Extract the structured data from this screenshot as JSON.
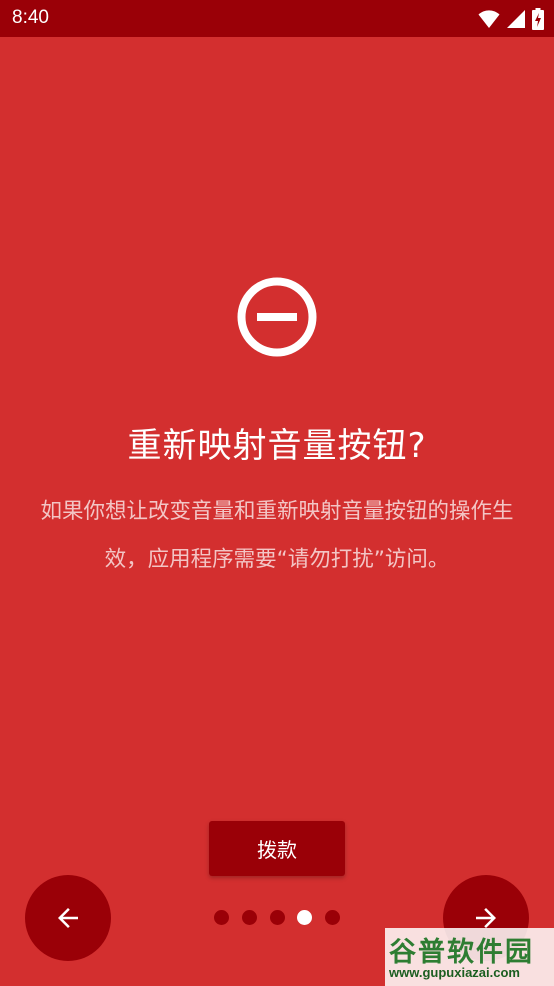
{
  "status_bar": {
    "time": "8:40"
  },
  "icons": {
    "hero": "do-not-disturb-icon",
    "prev": "arrow-left-icon",
    "next": "arrow-right-icon",
    "wifi": "wifi-icon",
    "signal": "signal-icon",
    "battery": "battery-charging-icon"
  },
  "main": {
    "title": "重新映射音量按钮?",
    "description": "如果你想让改变音量和重新映射音量按钮的操作生效，应用程序需要“请勿打扰”访问。"
  },
  "grant_button": {
    "label": "拨款"
  },
  "pager": {
    "total": 5,
    "active_index": 3
  },
  "watermark": {
    "title": "谷普软件园",
    "url": "www.gupuxiazai.com"
  },
  "colors": {
    "background": "#d32f2f",
    "dark": "#9a0007",
    "text": "#ffffff"
  }
}
